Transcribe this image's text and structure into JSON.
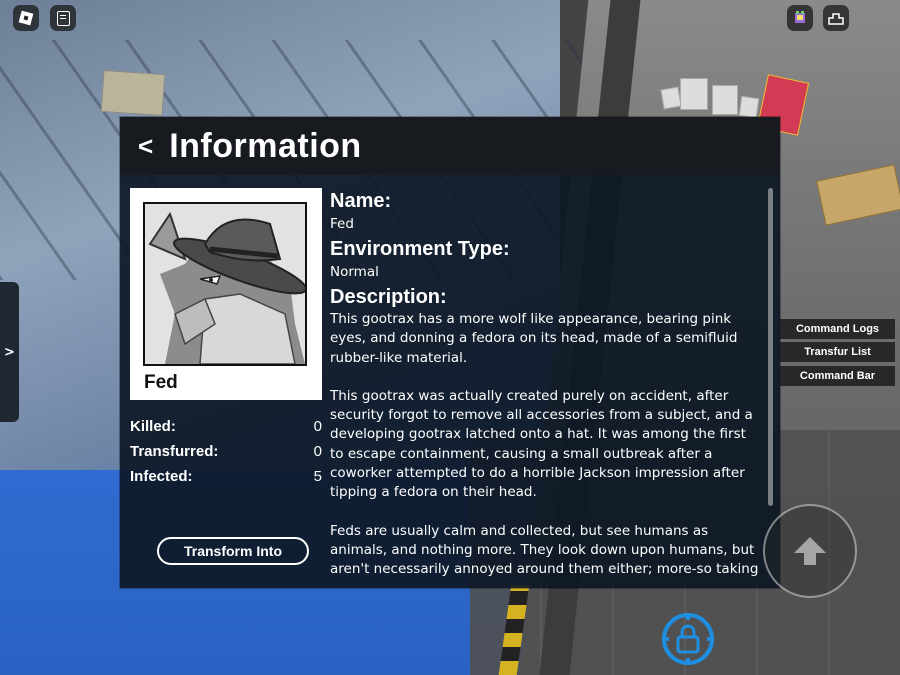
{
  "top_bar": {
    "roblox_menu_icon": "roblox-logo-icon",
    "chat_icon": "chat-icon",
    "right_icons": [
      "avatar-icon",
      "inventory-icon"
    ]
  },
  "side_toggle": {
    "label": ">"
  },
  "panel": {
    "back_label": "<",
    "title": "Information",
    "character": {
      "name": "Fed",
      "portrait_icon": "fedora-wolf-portrait"
    },
    "stats": [
      {
        "label": "Killed:",
        "value": "0"
      },
      {
        "label": "Transfurred:",
        "value": "0"
      },
      {
        "label": "Infected:",
        "value": "5"
      }
    ],
    "transform_button": "Transform Into",
    "fields": {
      "name_heading": "Name:",
      "name_value": "Fed",
      "environment_heading": "Environment Type:",
      "environment_value": "Normal",
      "description_heading": "Description:",
      "description_paragraphs": [
        "This gootrax has a more wolf like appearance, bearing pink eyes, and donning a fedora on its head, made of a semifluid rubber-like material.",
        "This gootrax was actually created purely on accident, after security forgot to remove all accessories from a subject, and a developing gootrax latched onto a hat. It was among the first to escape containment, causing a small outbreak after a coworker attempted to do a horrible Jackson impression after tipping a fedora on their head.",
        "Feds are usually calm and collected, but see humans as animals, and nothing more. They look down upon humans, but aren't necessarily annoyed around them either; more-so taking to"
      ]
    }
  },
  "side_menu": {
    "items": [
      "Command Logs",
      "Transfur List",
      "Command Bar"
    ]
  },
  "controls": {
    "jump_icon": "up-arrow-icon",
    "lock_icon": "padlock-icon",
    "accent_color": "#1e8fe0"
  }
}
